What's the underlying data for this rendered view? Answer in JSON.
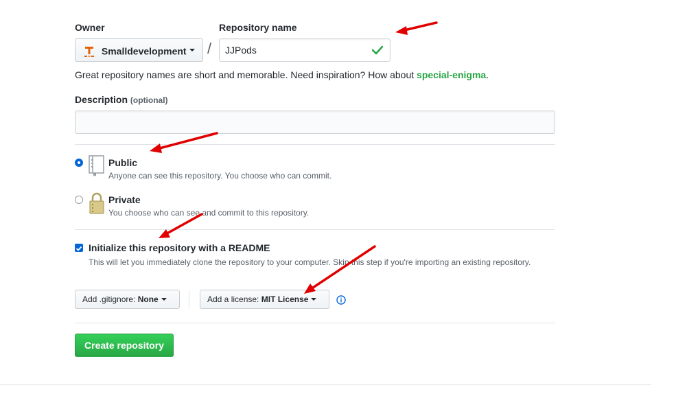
{
  "owner": {
    "label": "Owner",
    "selected": "Smalldevelopment",
    "avatar_icon": "org-avatar-icon"
  },
  "separator": "/",
  "repo_name": {
    "label": "Repository name",
    "value": "JJPods",
    "valid_icon": "check-icon"
  },
  "hint": {
    "text": "Great repository names are short and memorable. Need inspiration? How about ",
    "suggestion": "special-enigma",
    "end": "."
  },
  "description": {
    "label": "Description",
    "optional": "(optional)",
    "value": ""
  },
  "visibility": {
    "public": {
      "title": "Public",
      "text": "Anyone can see this repository. You choose who can commit.",
      "checked": true,
      "icon": "repo-book-icon"
    },
    "private": {
      "title": "Private",
      "text": "You choose who can see and commit to this repository.",
      "checked": false,
      "icon": "lock-icon"
    }
  },
  "init_readme": {
    "label": "Initialize this repository with a README",
    "text": "This will let you immediately clone the repository to your computer. Skip this step if you're importing an existing repository.",
    "checked": true
  },
  "gitignore": {
    "prefix": "Add .gitignore:",
    "value": "None"
  },
  "license": {
    "prefix": "Add a license:",
    "value": "MIT License",
    "info_icon": "info-icon"
  },
  "submit": {
    "label": "Create repository"
  },
  "colors": {
    "accent_green": "#2cbe4e",
    "link_green": "#28a745",
    "blue": "#0366d6",
    "annotation_red": "#e10000"
  }
}
